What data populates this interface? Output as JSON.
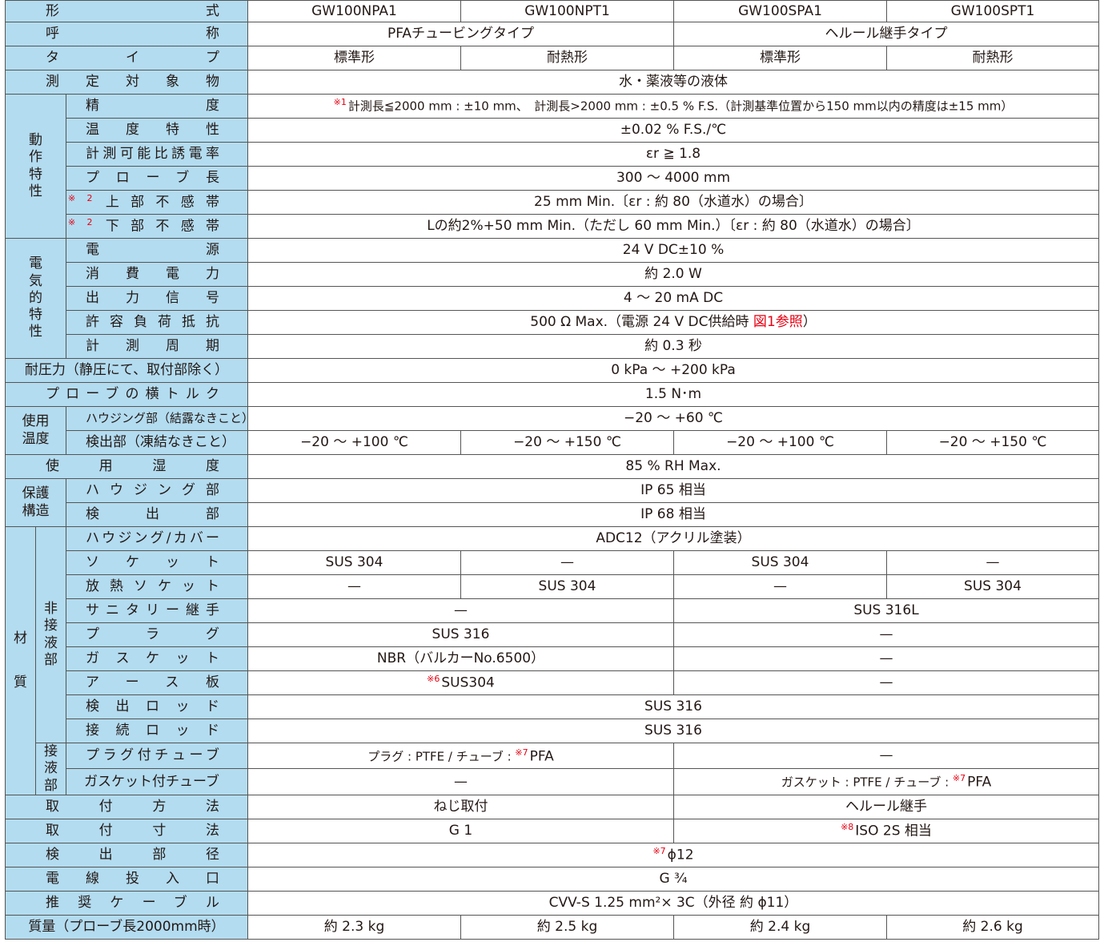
{
  "rows": {
    "model": {
      "label": "形式",
      "values": [
        "GW100NPA1",
        "GW100NPT1",
        "GW100SPA1",
        "GW100SPT1"
      ]
    },
    "name": {
      "label": "呼称",
      "values": [
        "PFAチュービングタイプ",
        "ヘルール継手タイプ"
      ]
    },
    "type": {
      "label": "タイプ",
      "values": [
        "標準形",
        "耐熱形",
        "標準形",
        "耐熱形"
      ]
    },
    "target": {
      "label": "測定対象物",
      "value": "水・薬液等の液体"
    },
    "operating": {
      "group": [
        "動",
        "作",
        "特",
        "性"
      ],
      "accuracy": {
        "label": "精度",
        "mark": "※1",
        "value": "計測長≦2000 mm : ±10 mm、　計測長>2000 mm : ±0.5 % F.S.（計測基準位置から150 mm以内の精度は±15 mm）"
      },
      "temp_char": {
        "label": "温度特性",
        "value": "±0.02 %  F.S./℃"
      },
      "permittivity": {
        "label": "計測可能比誘電率",
        "value": "εr ≧ 1.8"
      },
      "probe_length": {
        "label": "プローブ長",
        "value": "300 ～ 4000 mm"
      },
      "upper_dead": {
        "label": "上部不感帯",
        "mark": "※2",
        "value": "25 mm Min.〔εr : 約 80（水道水）の場合〕"
      },
      "lower_dead": {
        "label": "下部不感帯",
        "mark": "※2",
        "value": "Lの約2%+50 mm Min.（ただし 60 mm Min.）〔εr : 約 80（水道水）の場合〕"
      }
    },
    "electrical": {
      "group": [
        "電",
        "気",
        "的",
        "特",
        "性"
      ],
      "power": {
        "label": "電源",
        "value": "24 V  DC±10 %"
      },
      "consumption": {
        "label": "消費電力",
        "value": "約 2.0 W"
      },
      "output": {
        "label": "出力信号",
        "value": "4 ～ 20 mA DC"
      },
      "load": {
        "label": "許容負荷抵抗",
        "value": "500 Ω Max.（電源 24 V DC供給時 ",
        "ref": "図1参照",
        "close": "）"
      },
      "cycle": {
        "label": "計測周期",
        "value": "約 0.3 秒"
      }
    },
    "pressure": {
      "label": "耐圧力（静圧にて、取付部除く）",
      "value": "0 kPa ～ +200 kPa"
    },
    "torque": {
      "label": "プローブの横トルク",
      "value": "1.5 N･m"
    },
    "use_temp": {
      "group": [
        "使用",
        "温度"
      ],
      "housing": {
        "label": "ハウジング部（結露なきこと）",
        "value": "−20 ～ +60 ℃"
      },
      "detector": {
        "label": "検出部（凍結なきこと）",
        "values": [
          "−20 ～ +100 ℃",
          "−20 ～ +150 ℃",
          "−20 ～ +100 ℃",
          "−20 ～ +150 ℃"
        ]
      }
    },
    "humidity": {
      "label": "使用湿度",
      "value": "85 % RH Max."
    },
    "protection": {
      "group": [
        "保護",
        "構造"
      ],
      "housing": {
        "label": "ハウジング部",
        "value": "IP 65 相当"
      },
      "detector": {
        "label": "検出部",
        "value": "IP 68 相当"
      }
    },
    "material": {
      "group": [
        "材",
        "質"
      ],
      "non_wetted_group": [
        "非",
        "接",
        "液",
        "部"
      ],
      "wetted_group": [
        "接",
        "液",
        "部"
      ],
      "housing_cover": {
        "label": "ハウジング/カバー",
        "value": "ADC12（アクリル塗装）"
      },
      "socket": {
        "label": "ソケット",
        "values": [
          "SUS 304",
          "—",
          "SUS 304",
          "—"
        ]
      },
      "heat_socket": {
        "label": "放熱ソケット",
        "values": [
          "—",
          "SUS 304",
          "—",
          "SUS 304"
        ]
      },
      "sanitary": {
        "label": "サニタリー継手",
        "values": [
          "—",
          "SUS 316L"
        ]
      },
      "plug": {
        "label": "プラグ",
        "values": [
          "SUS 316",
          "—"
        ]
      },
      "gasket": {
        "label": "ガスケット",
        "values": [
          "NBR（バルカーNo.6500）",
          "—"
        ]
      },
      "earth": {
        "label": "アース板",
        "mark": "※6",
        "values": [
          "SUS304",
          "—"
        ]
      },
      "detect_rod": {
        "label": "検出ロッド",
        "value": "SUS 316"
      },
      "connect_rod": {
        "label": "接続ロッド",
        "value": "SUS 316"
      },
      "plug_tube": {
        "label": "プラグ付チューブ",
        "value_pre": "プラグ : PTFE / チューブ : ",
        "mark": "※7",
        "value_post": "PFA",
        "other": "—"
      },
      "gasket_tube": {
        "label": "ガスケット付チューブ",
        "other": "—",
        "value_pre": "ガスケット : PTFE / チューブ : ",
        "mark": "※7",
        "value_post": "PFA"
      }
    },
    "mounting": {
      "label": "取付方法",
      "values": [
        "ねじ取付",
        "ヘルール継手"
      ]
    },
    "mount_size": {
      "label": "取付寸法",
      "values": [
        "G 1",
        "ISO 2S 相当"
      ],
      "mark": "※8"
    },
    "detector_dia": {
      "label": "検出部径",
      "mark": "※7",
      "value": "ϕ12"
    },
    "cable_entry": {
      "label": "電線投入口",
      "value": "G ³⁄₄"
    },
    "cable": {
      "label": "推奨ケーブル",
      "value": "CVV-S 1.25 mm²× 3C（外径 約 ϕ11）"
    },
    "mass": {
      "label": "質量（プローブ長2000mm時）",
      "values": [
        "約 2.3 kg",
        "約 2.5 kg",
        "約 2.4 kg",
        "約 2.6 kg"
      ]
    }
  }
}
